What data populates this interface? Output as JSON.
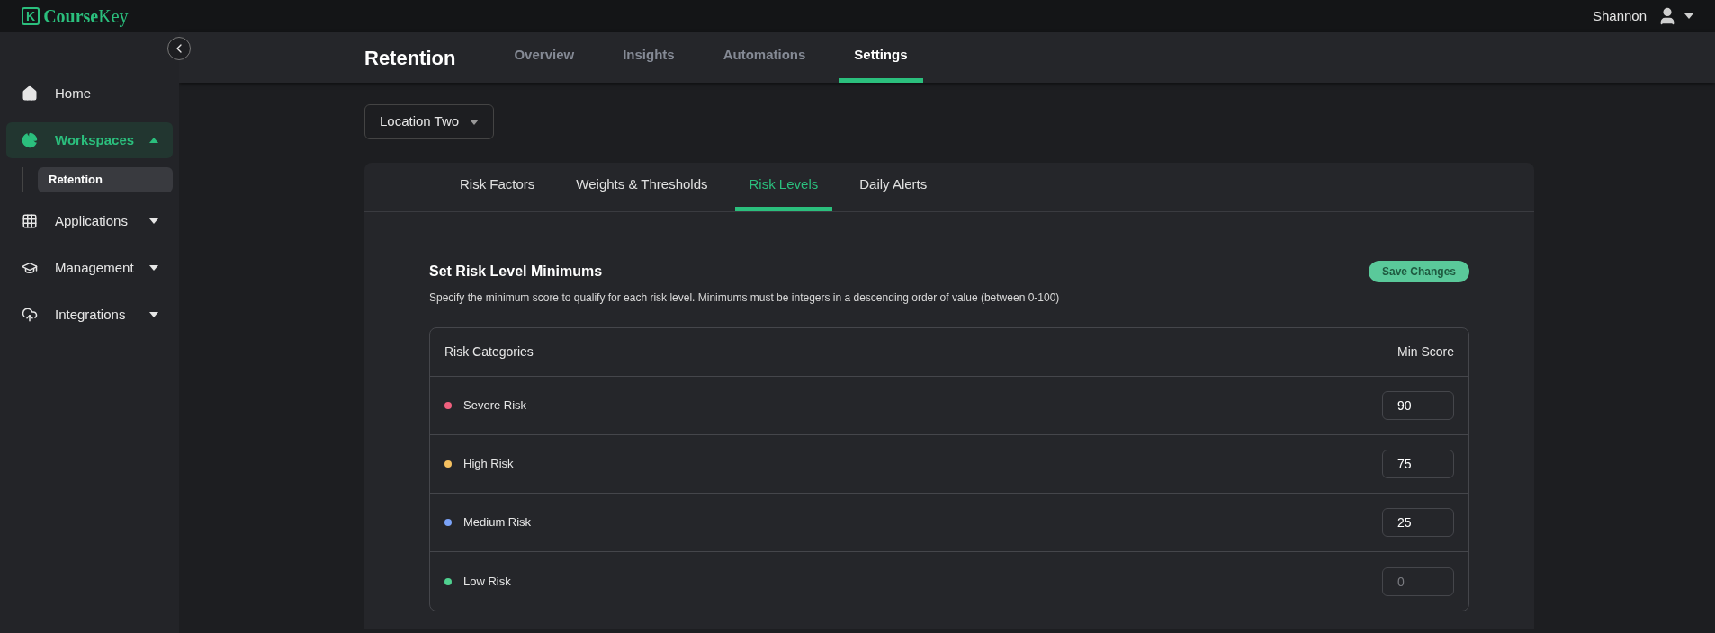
{
  "topbar": {
    "logo_mark": "K",
    "logo_text_bold": "Course",
    "logo_text_light": "Key",
    "user_name": "Shannon"
  },
  "sidebar": {
    "items": [
      {
        "label": "Home",
        "kind": "home",
        "selected": false
      },
      {
        "label": "Workspaces",
        "kind": "workspaces",
        "selected": true,
        "expanded": true,
        "children": [
          {
            "label": "Retention",
            "selected": true
          }
        ]
      },
      {
        "label": "Applications",
        "kind": "applications",
        "selected": false,
        "expanded": false
      },
      {
        "label": "Management",
        "kind": "management",
        "selected": false,
        "expanded": false
      },
      {
        "label": "Integrations",
        "kind": "integrations",
        "selected": false,
        "expanded": false
      }
    ]
  },
  "header": {
    "title": "Retention",
    "tabs": [
      {
        "label": "Overview",
        "selected": false
      },
      {
        "label": "Insights",
        "selected": false
      },
      {
        "label": "Automations",
        "selected": false
      },
      {
        "label": "Settings",
        "selected": true
      }
    ]
  },
  "location_select": {
    "value": "Location Two"
  },
  "settings_tabs": [
    {
      "label": "Risk Factors",
      "selected": false
    },
    {
      "label": "Weights & Thresholds",
      "selected": false
    },
    {
      "label": "Risk Levels",
      "selected": true
    },
    {
      "label": "Daily Alerts",
      "selected": false
    }
  ],
  "section": {
    "title": "Set Risk Level Minimums",
    "description": "Specify the minimum score to qualify for each risk level. Minimums must be integers in a descending order of value (between 0-100)",
    "save_button": {
      "label": "Save Changes",
      "disabled": true
    }
  },
  "table": {
    "columns": [
      "Risk Categories",
      "Min Score"
    ],
    "rows": [
      {
        "category": "Severe Risk",
        "color": "#f0607e",
        "min_score": "90",
        "disabled": false
      },
      {
        "category": "High Risk",
        "color": "#f5c060",
        "min_score": "75",
        "disabled": false
      },
      {
        "category": "Medium Risk",
        "color": "#7aa2f7",
        "min_score": "25",
        "disabled": false
      },
      {
        "category": "Low Risk",
        "color": "#4fd08f",
        "min_score": "0",
        "disabled": true
      }
    ]
  }
}
